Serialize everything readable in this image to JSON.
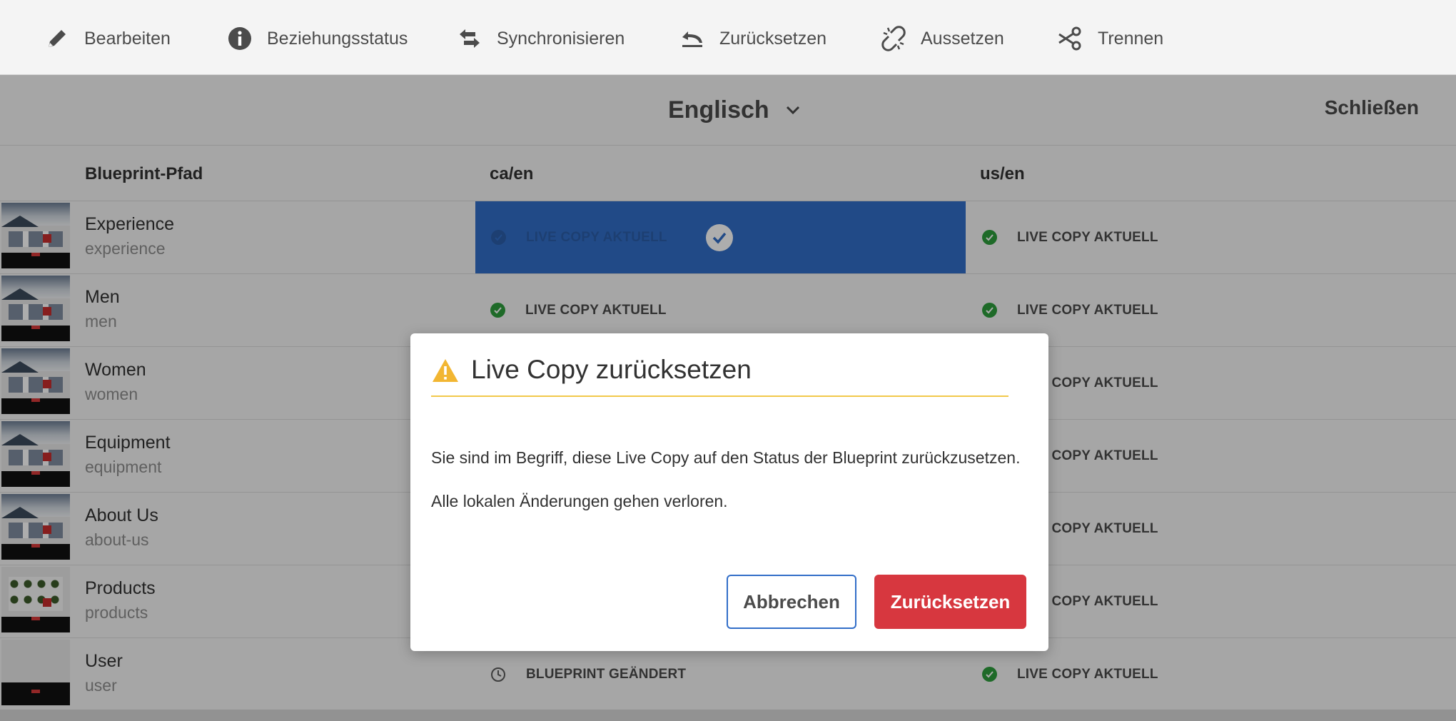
{
  "toolbar": {
    "items": [
      {
        "label": "Bearbeiten",
        "icon": "pencil-icon"
      },
      {
        "label": "Beziehungsstatus",
        "icon": "info-icon"
      },
      {
        "label": "Synchronisieren",
        "icon": "sync-arrows-icon"
      },
      {
        "label": "Zurücksetzen",
        "icon": "undo-icon"
      },
      {
        "label": "Aussetzen",
        "icon": "broken-link-icon"
      },
      {
        "label": "Trennen",
        "icon": "scissors-icon"
      }
    ]
  },
  "language": {
    "selected": "Englisch",
    "icon": "chevron-down-icon"
  },
  "close_label": "Schließen",
  "table": {
    "columns": [
      "Blueprint-Pfad",
      "ca/en",
      "us/en"
    ],
    "rows": [
      {
        "name": "Experience",
        "path": "experience",
        "ca": "LIVE COPY AKTUELL",
        "us": "LIVE COPY AKTUELL",
        "ca_state": "selected"
      },
      {
        "name": "Men",
        "path": "men",
        "ca": "LIVE COPY AKTUELL",
        "us": "LIVE COPY AKTUELL"
      },
      {
        "name": "Women",
        "path": "women",
        "ca": "",
        "us": "LIVE COPY AKTUELL"
      },
      {
        "name": "Equipment",
        "path": "equipment",
        "ca": "",
        "us": "LIVE COPY AKTUELL"
      },
      {
        "name": "About Us",
        "path": "about-us",
        "ca": "",
        "us": "LIVE COPY AKTUELL"
      },
      {
        "name": "Products",
        "path": "products",
        "ca": "",
        "us": "LIVE COPY AKTUELL"
      },
      {
        "name": "User",
        "path": "user",
        "ca": "BLUEPRINT GEÄNDERT",
        "us": "LIVE COPY AKTUELL"
      }
    ]
  },
  "dialog": {
    "title": "Live Copy zurücksetzen",
    "icon": "warning-icon",
    "line1": "Sie sind im Begriff, diese Live Copy auf den Status der Blueprint zurückzusetzen.",
    "line2": "Alle lokalen Änderungen gehen verloren.",
    "cancel_label": "Abbrechen",
    "confirm_label": "Zurücksetzen"
  },
  "colors": {
    "accent_blue": "#326ec8",
    "success_green": "#2d9d3c",
    "warning_yellow": "#f2c84b",
    "danger_red": "#d7373f"
  }
}
